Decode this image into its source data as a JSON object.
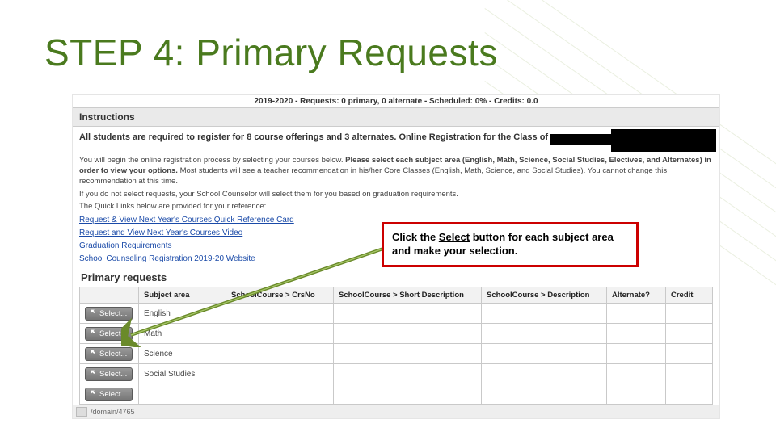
{
  "title": "STEP 4:  Primary Requests",
  "banner": "2019-2020 - Requests: 0 primary, 0 alternate - Scheduled: 0% - Credits: 0.0",
  "instructions_label": "Instructions",
  "bold_intro": "All students are required to register for 8 course offerings and 3 alternates. Online Registration for the Class of",
  "para1_a": "You will begin the online registration process by selecting your courses below. ",
  "para1_b": "Please select each subject area (English, Math, Science, Social Studies, Electives, and Alternates) in order to view your options.",
  "para1_c": " Most students will see a teacher recommendation in his/her Core Classes (English, Math, Science, and Social Studies). You cannot change this recommendation at this time.",
  "para2": "If you do not select requests, your School Counselor will select them for you based on graduation requirements.",
  "para3": "The Quick Links below are provided for your reference:",
  "links": [
    "Request & View Next Year's Courses Quick Reference Card",
    "Request and View Next Year's Courses Video",
    "Graduation Requirements",
    "School Counseling Registration 2019-20 Website"
  ],
  "primary_label": "Primary requests",
  "table": {
    "headers": [
      "",
      "Subject area",
      "SchoolCourse > CrsNo",
      "SchoolCourse > Short Description",
      "SchoolCourse > Description",
      "Alternate?",
      "Credit"
    ],
    "select_label": "Select...",
    "rows": [
      {
        "subject": "English"
      },
      {
        "subject": "Math"
      },
      {
        "subject": "Science"
      },
      {
        "subject": "Social Studies"
      },
      {
        "subject": ""
      }
    ]
  },
  "status_path": "/domain/4765",
  "callout_a": "Click the ",
  "callout_b": "Select",
  "callout_c": " button for each subject area and make your selection."
}
